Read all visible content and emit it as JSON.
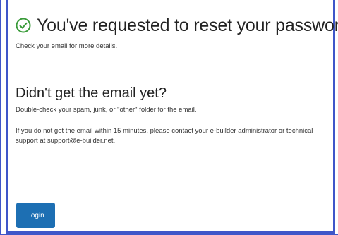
{
  "header": {
    "title": "You've requested to reset your password",
    "subtitle": "Check your email for more details."
  },
  "help": {
    "heading": "Didn't get the email yet?",
    "tip": "Double-check your spam, junk, or \"other\" folder for the email.",
    "contact": "If you do not get the email within 15 minutes, please contact your e-builder administrator or technical support at support@e-builder.net."
  },
  "actions": {
    "login_label": "Login"
  },
  "icons": {
    "success": "check-circle-icon"
  },
  "colors": {
    "accent": "#1d6fb3",
    "success": "#3a9b3a",
    "frame": "#3f56c9"
  }
}
